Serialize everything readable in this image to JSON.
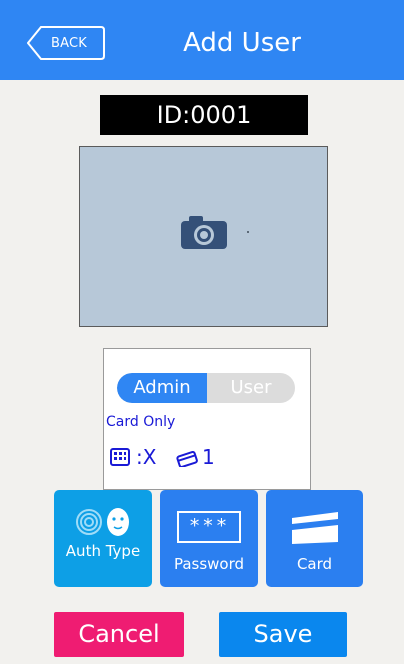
{
  "header": {
    "back_label": "BACK",
    "title": "Add User"
  },
  "user": {
    "id_text": "ID:0001"
  },
  "photo": {
    "icon": "camera-icon"
  },
  "info_panel": {
    "toggle": {
      "admin_label": "Admin",
      "user_label": "User",
      "selected": "Admin"
    },
    "auth_mode": "Card Only",
    "fingerprint_status_value": ":X",
    "card_count_value": "1"
  },
  "tiles": [
    {
      "label": "Auth Type",
      "icon": "fingerprint-face-icon",
      "color": "#0d9fe6"
    },
    {
      "label": "Password",
      "icon": "password-icon",
      "color": "#2b7ff0",
      "field_text": "***"
    },
    {
      "label": "Card",
      "icon": "card-icon",
      "color": "#2b7ff0"
    }
  ],
  "actions": {
    "cancel_label": "Cancel",
    "save_label": "Save"
  },
  "colors": {
    "header": "#2f86f3",
    "cancel": "#ef1c72",
    "save": "#0a87ee",
    "accent_text": "#1a1ad6"
  }
}
